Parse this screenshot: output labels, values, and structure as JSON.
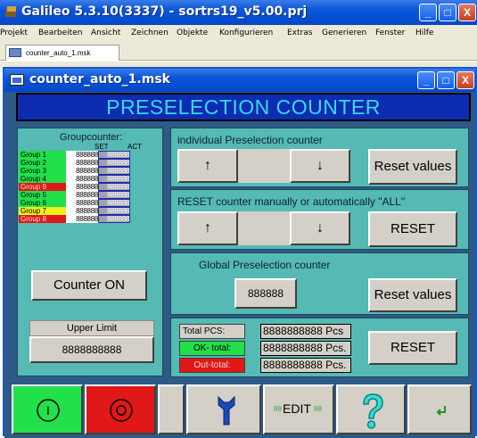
{
  "app": {
    "title": "Galileo 5.3.10(3337) - sortrs19_v5.00.prj",
    "window_buttons": [
      "_",
      "□",
      "X"
    ]
  },
  "menu": [
    "Projekt",
    "Bearbeiten",
    "Ansicht",
    "Zeichnen",
    "Objekte",
    "Konfigurieren",
    "Extras",
    "Generieren",
    "Fenster",
    "Hilfe"
  ],
  "tab": {
    "label": "counter_auto_1.msk"
  },
  "inner": {
    "title": "counter_auto_1.msk",
    "header": "PRESELECTION COUNTER"
  },
  "groupcounter": {
    "title": "Groupcounter:",
    "set_label": "SET",
    "act_label": "ACT",
    "groups": [
      {
        "label": "Group 1",
        "set": "888888",
        "act": "888888",
        "color": "#22e04a"
      },
      {
        "label": "Group 2",
        "set": "888888",
        "act": "888888",
        "color": "#22e04a"
      },
      {
        "label": "Group 3",
        "set": "888888",
        "act": "888888",
        "color": "#22e04a"
      },
      {
        "label": "Group 4",
        "set": "888888",
        "act": "888888",
        "color": "#22e04a"
      },
      {
        "label": "Group 9",
        "set": "888888",
        "act": "888888",
        "color": "#e01818"
      },
      {
        "label": "Group 5",
        "set": "888888",
        "act": "888888",
        "color": "#22e04a"
      },
      {
        "label": "Group 6",
        "set": "888888",
        "act": "888888",
        "color": "#22e04a"
      },
      {
        "label": "Group 7",
        "set": "888888",
        "act": "888888",
        "color": "#f0f020"
      },
      {
        "label": "Group 8",
        "set": "888888",
        "act": "888888",
        "color": "#e01818"
      }
    ],
    "counter_button": "Counter ON",
    "upper_limit_label": "Upper Limit",
    "upper_limit_value": "8888888888"
  },
  "individual": {
    "title": "individual Preselection counter",
    "up": "↑",
    "down": "↓",
    "reset": "Reset values"
  },
  "reset_counter": {
    "title": "RESET counter manually or automatically \"ALL\"",
    "up": "↑",
    "down": "↓",
    "reset": "RESET"
  },
  "global": {
    "title": "Global Preselection counter",
    "value": "888888",
    "reset": "Reset values"
  },
  "totals": {
    "total_label": "Total PCS:",
    "total_value": "8888888888 Pcs",
    "ok_label": "OK- total:",
    "ok_value": "8888888888 Pcs.",
    "out_label": "Out-total:",
    "out_value": "8888888888 Pcs.",
    "reset": "RESET",
    "ok_color": "#22e04a",
    "out_color": "#e01818"
  },
  "toolbar": {
    "start_icon": "I",
    "stop_icon": "O",
    "edit_label": "EDIT",
    "edit_prefix": "88",
    "edit_suffix": "88",
    "start_color": "#22e04a",
    "stop_color": "#e01818"
  }
}
